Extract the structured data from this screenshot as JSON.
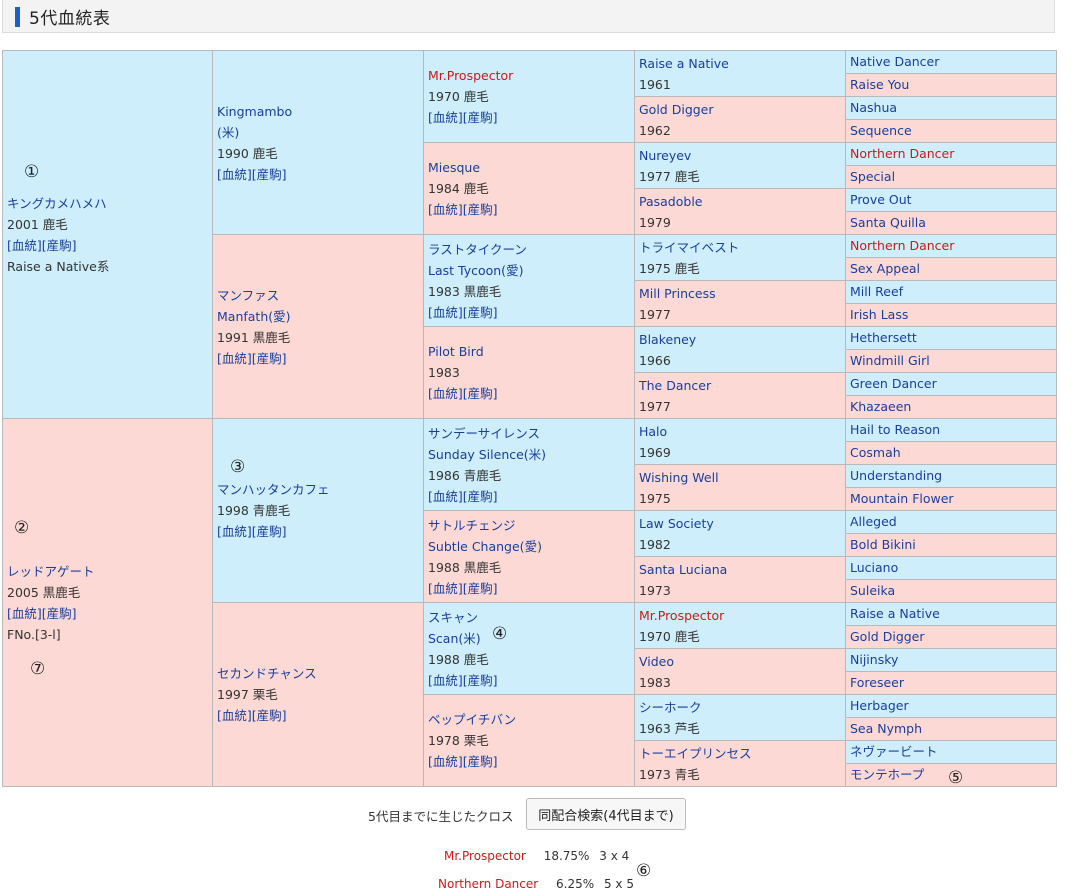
{
  "title": "5代血統表",
  "links": {
    "pedigree": "[血統]",
    "produce": "[産駒]"
  },
  "annotations": [
    "①",
    "②",
    "③",
    "④",
    "⑤",
    "⑥",
    "⑦"
  ],
  "gen1": [
    {
      "name": "キングカメハメハ",
      "detail": "2001 鹿毛",
      "extra": "Raise a Native系"
    },
    {
      "name": "レッドアゲート",
      "detail": "2005 黒鹿毛",
      "extra": "FNo.[3-l]"
    }
  ],
  "gen2": [
    {
      "name": "Kingmambo",
      "name2": "(米)",
      "detail": "1990 鹿毛"
    },
    {
      "name": "マンファス",
      "name2": "Manfath(愛)",
      "detail": "1991 黒鹿毛"
    },
    {
      "name": "マンハッタンカフェ",
      "detail": "1998 青鹿毛"
    },
    {
      "name": "セカンドチャンス",
      "detail": "1997 栗毛"
    }
  ],
  "gen3": [
    {
      "name": "Mr.Prospector",
      "detail": "1970 鹿毛"
    },
    {
      "name": "Miesque",
      "detail": "1984 鹿毛"
    },
    {
      "name": "ラストタイクーン",
      "name2": "Last Tycoon(愛)",
      "detail": "1983 黒鹿毛"
    },
    {
      "name": "Pilot Bird",
      "detail": "1983"
    },
    {
      "name": "サンデーサイレンス",
      "name2": "Sunday Silence(米)",
      "detail": "1986 青鹿毛"
    },
    {
      "name": "サトルチェンジ",
      "name2": "Subtle Change(愛)",
      "detail": "1988 黒鹿毛"
    },
    {
      "name": "スキャン",
      "name2": "Scan(米)",
      "detail": "1988 鹿毛"
    },
    {
      "name": "ベップイチバン",
      "detail": "1978 栗毛"
    }
  ],
  "gen4": [
    {
      "name": "Raise a Native",
      "detail": "1961"
    },
    {
      "name": "Gold Digger",
      "detail": "1962"
    },
    {
      "name": "Nureyev",
      "detail": "1977 鹿毛"
    },
    {
      "name": "Pasadoble",
      "detail": "1979"
    },
    {
      "name": "トライマイベスト",
      "detail": "1975 鹿毛"
    },
    {
      "name": "Mill Princess",
      "detail": "1977"
    },
    {
      "name": "Blakeney",
      "detail": "1966"
    },
    {
      "name": "The Dancer",
      "detail": "1977"
    },
    {
      "name": "Halo",
      "detail": "1969"
    },
    {
      "name": "Wishing Well",
      "detail": "1975"
    },
    {
      "name": "Law Society",
      "detail": "1982"
    },
    {
      "name": "Santa Luciana",
      "detail": "1973"
    },
    {
      "name": "Mr.Prospector",
      "detail": "1970 鹿毛"
    },
    {
      "name": "Video",
      "detail": "1983"
    },
    {
      "name": "シーホーク",
      "detail": "1963 芦毛"
    },
    {
      "name": "トーエイプリンセス",
      "detail": "1973 青毛"
    }
  ],
  "gen5": [
    "Native Dancer",
    "Raise You",
    "Nashua",
    "Sequence",
    "Northern Dancer",
    "Special",
    "Prove Out",
    "Santa Quilla",
    "Northern Dancer",
    "Sex Appeal",
    "Mill Reef",
    "Irish Lass",
    "Hethersett",
    "Windmill Girl",
    "Green Dancer",
    "Khazaeen",
    "Hail to Reason",
    "Cosmah",
    "Understanding",
    "Mountain Flower",
    "Alleged",
    "Bold Bikini",
    "Luciano",
    "Suleika",
    "Raise a Native",
    "Gold Digger",
    "Nijinsky",
    "Foreseer",
    "Herbager",
    "Sea Nymph",
    "ネヴァービート",
    "モンテホープ"
  ],
  "cross": {
    "label": "5代目までに生じたクロス",
    "button": "同配合検索(4代目まで)",
    "rows": [
      {
        "name": "Mr.Prospector",
        "pct": "18.75%",
        "gen": "3 x 4"
      },
      {
        "name": "Northern Dancer",
        "pct": "6.25%",
        "gen": "5 x 5"
      }
    ]
  },
  "colors": {
    "sire_bg": "#cdeefa",
    "dam_bg": "#fcd9d5",
    "link": "#1a3f9a",
    "cross_name": "#cc1a1a",
    "header_bar": "#1f5fbf"
  }
}
